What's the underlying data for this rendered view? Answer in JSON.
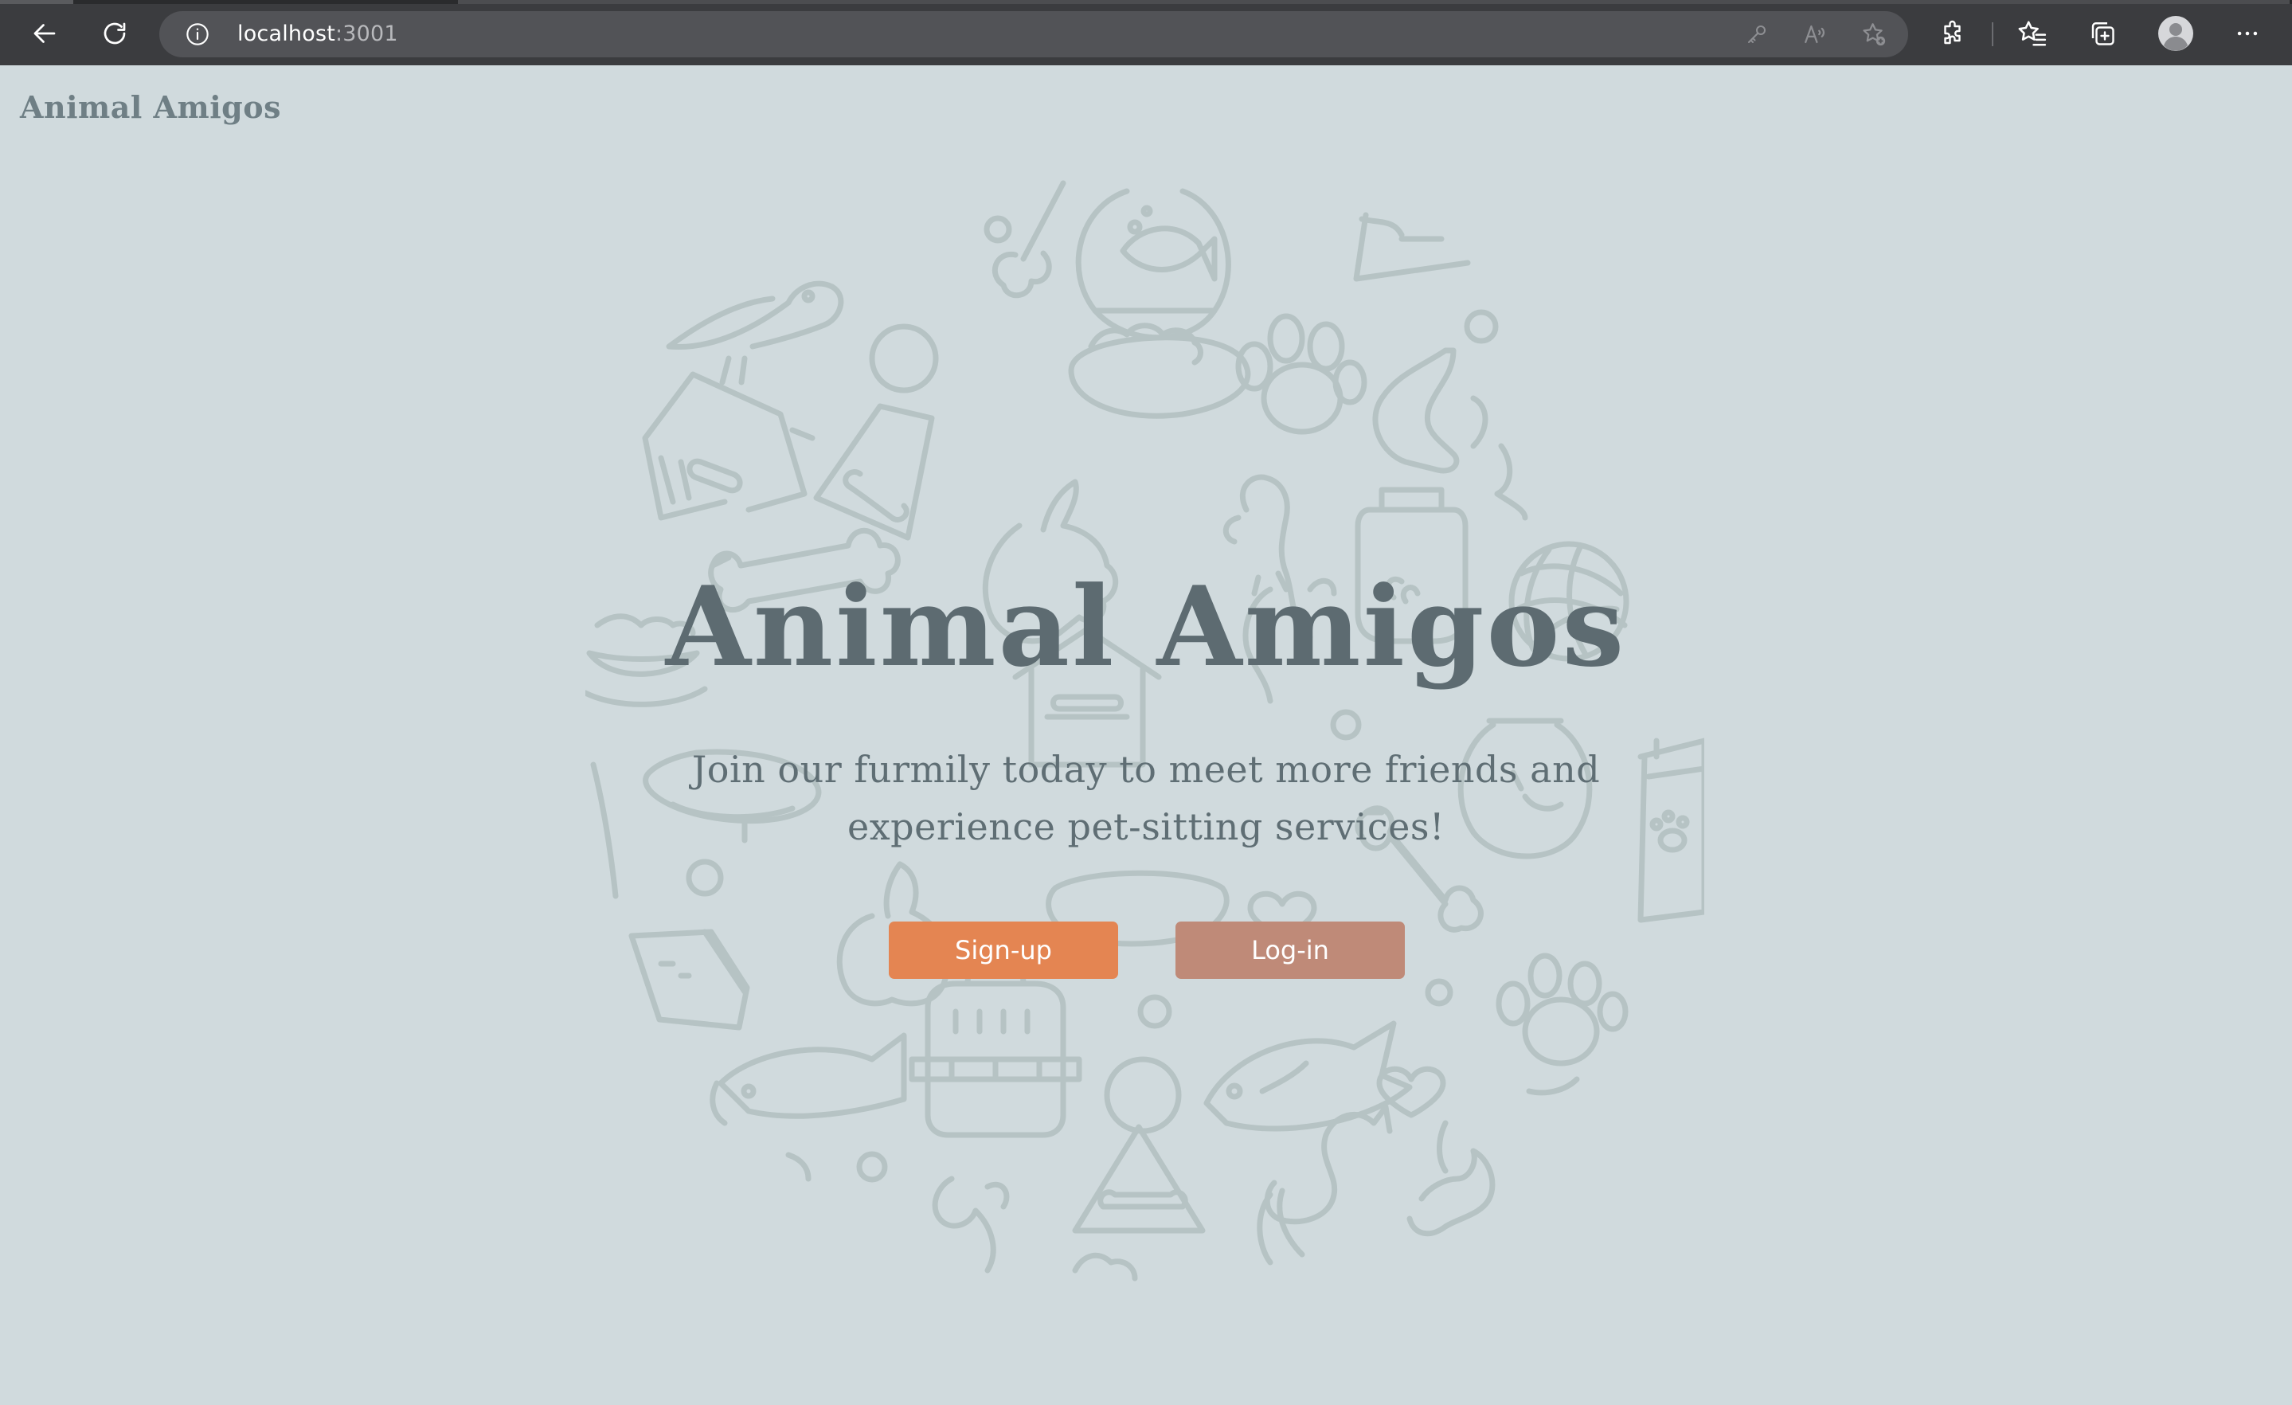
{
  "browser": {
    "url_host": "localhost",
    "url_port": ":3001",
    "icons": {
      "back": "back-arrow-icon",
      "reload": "reload-icon",
      "info": "info-icon",
      "key": "key-icon",
      "read_aloud": "read-aloud-icon",
      "add_favorite": "add-favorite-icon",
      "extensions": "extensions-icon",
      "favorites": "favorites-icon",
      "collections": "collections-icon",
      "profile": "profile-avatar-icon",
      "menu": "more-menu-icon"
    }
  },
  "site": {
    "logo": "Animal Amigos"
  },
  "hero": {
    "title": "Animal Amigos",
    "subtitle": "Join our furmily today to meet more friends and experience pet-sitting services!",
    "signup_label": "Sign-up",
    "login_label": "Log-in"
  },
  "colors": {
    "background": "#d0dadd",
    "doodle": "#b6c3c4",
    "title": "#5d6b71",
    "signup": "#e48552",
    "login": "#bf8a78"
  }
}
